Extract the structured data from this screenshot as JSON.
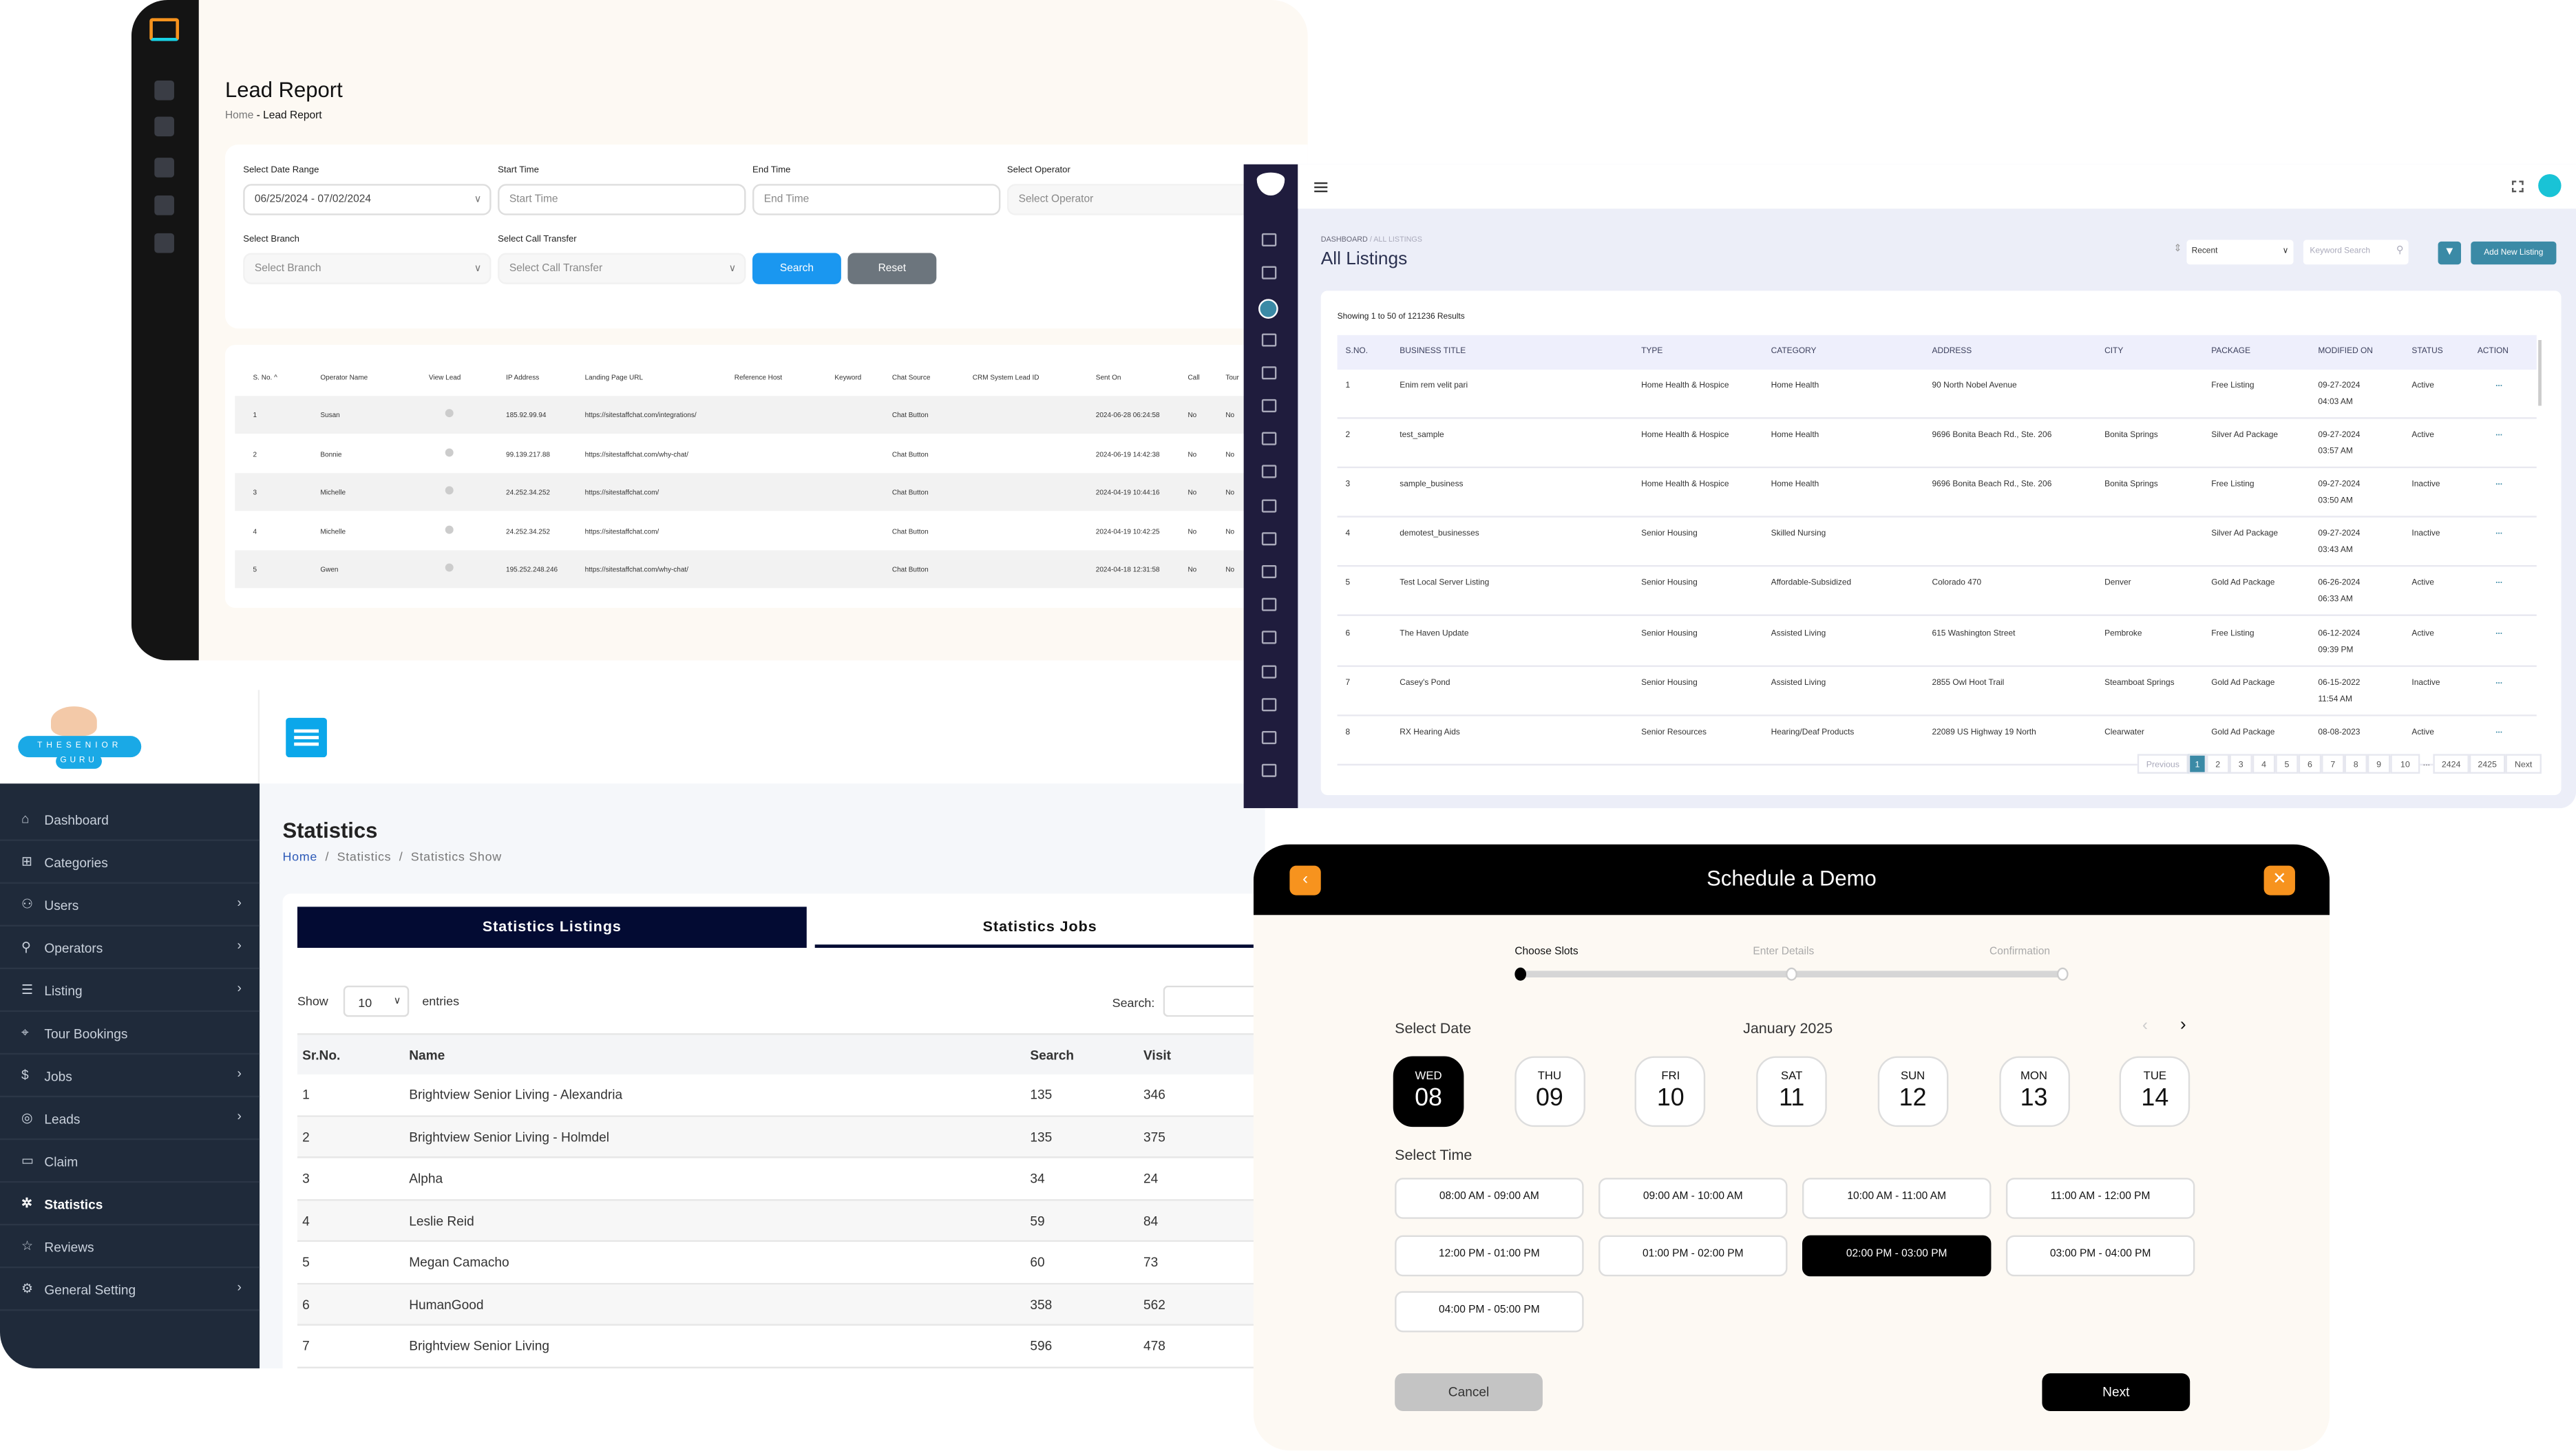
{
  "lead_report": {
    "title": "Lead Report",
    "breadcrumb_home": "Home",
    "breadcrumb_sep": "-",
    "breadcrumb_current": "Lead Report",
    "filters": {
      "date_range_label": "Select Date Range",
      "date_range_value": "06/25/2024 - 07/02/2024",
      "start_label": "Start Time",
      "start_placeholder": "Start Time",
      "end_label": "End Time",
      "end_placeholder": "End Time",
      "operator_label": "Select Operator",
      "operator_placeholder": "Select Operator",
      "branch_label": "Select Branch",
      "branch_placeholder": "Select Branch",
      "transfer_label": "Select Call Transfer",
      "transfer_placeholder": "Select Call Transfer",
      "search": "Search",
      "reset": "Reset"
    },
    "columns": [
      "S. No. ^",
      "Operator Name",
      "View Lead",
      "IP Address",
      "Landing Page URL",
      "Reference Host",
      "Keyword",
      "Chat Source",
      "CRM System Lead ID",
      "Sent On",
      "Call",
      "Tour"
    ],
    "rows": [
      [
        "1",
        "Susan",
        "185.92.99.94",
        "https://sitestaffchat.com/integrations/",
        "Chat Button",
        "2024-06-28 06:24:58",
        "No",
        "No"
      ],
      [
        "2",
        "Bonnie",
        "99.139.217.88",
        "https://sitestaffchat.com/why-chat/",
        "Chat Button",
        "2024-06-19 14:42:38",
        "No",
        "No"
      ],
      [
        "3",
        "Michelle",
        "24.252.34.252",
        "https://sitestaffchat.com/",
        "Chat Button",
        "2024-04-19 10:44:16",
        "No",
        "No"
      ],
      [
        "4",
        "Michelle",
        "24.252.34.252",
        "https://sitestaffchat.com/",
        "Chat Button",
        "2024-04-19 10:42:25",
        "No",
        "No"
      ],
      [
        "5",
        "Gwen",
        "195.252.248.246",
        "https://sitestaffchat.com/why-chat/",
        "Chat Button",
        "2024-04-18 12:31:58",
        "No",
        "No"
      ]
    ]
  },
  "listings": {
    "breadcrumb": "DASHBOARD",
    "breadcrumb_sep": "/",
    "breadcrumb_current": "ALL LISTINGS",
    "title": "All Listings",
    "sort_value": "Recent",
    "search_placeholder": "Keyword Search",
    "add_button": "Add New Listing",
    "showing": "Showing 1 to 50 of 121236 Results",
    "columns": [
      "S.NO.",
      "BUSINESS TITLE",
      "TYPE",
      "CATEGORY",
      "ADDRESS",
      "CITY",
      "PACKAGE",
      "MODIFIED ON",
      "STATUS",
      "ACTION"
    ],
    "rows": [
      [
        "1",
        "Enim rem velit pari",
        "Home Health & Hospice",
        "Home Health",
        "90 North Nobel Avenue",
        "",
        "Free Listing",
        "09-27-2024",
        "04:03 AM",
        "Active"
      ],
      [
        "2",
        "test_sample",
        "Home Health & Hospice",
        "Home Health",
        "9696 Bonita Beach Rd., Ste. 206",
        "Bonita Springs",
        "Silver Ad Package",
        "09-27-2024",
        "03:57 AM",
        "Active"
      ],
      [
        "3",
        "sample_business",
        "Home Health & Hospice",
        "Home Health",
        "9696 Bonita Beach Rd., Ste. 206",
        "Bonita Springs",
        "Free Listing",
        "09-27-2024",
        "03:50 AM",
        "Inactive"
      ],
      [
        "4",
        "demotest_businesses",
        "Senior Housing",
        "Skilled Nursing",
        "",
        "",
        "Silver Ad Package",
        "09-27-2024",
        "03:43 AM",
        "Inactive"
      ],
      [
        "5",
        "Test Local Server Listing",
        "Senior Housing",
        "Affordable-Subsidized",
        "Colorado 470",
        "Denver",
        "Gold Ad Package",
        "06-26-2024",
        "06:33 AM",
        "Active"
      ],
      [
        "6",
        "The Haven Update",
        "Senior Housing",
        "Assisted Living",
        "615 Washington Street",
        "Pembroke",
        "Free Listing",
        "06-12-2024",
        "09:39 PM",
        "Active"
      ],
      [
        "7",
        "Casey's Pond",
        "Senior Housing",
        "Assisted Living",
        "2855 Owl Hoot Trail",
        "Steamboat Springs",
        "Gold Ad Package",
        "06-15-2022",
        "11:54 AM",
        "Inactive"
      ],
      [
        "8",
        "RX Hearing Aids",
        "Senior Resources",
        "Hearing/Deaf Products",
        "22089 US Highway 19 North",
        "Clearwater",
        "Gold Ad Package",
        "08-08-2023",
        "",
        "Active"
      ]
    ],
    "action_label": "...",
    "pagination": [
      "Previous",
      "1",
      "2",
      "3",
      "4",
      "5",
      "6",
      "7",
      "8",
      "9",
      "10",
      "...",
      "2424",
      "2425",
      "Next"
    ],
    "current_page": "1",
    "accent": "#3b8aa6"
  },
  "statistics": {
    "logo_text": "THE SENIOR GURU",
    "nav": [
      {
        "icon": "⌂",
        "label": "Dashboard",
        "arrow": false
      },
      {
        "icon": "⊞",
        "label": "Categories",
        "arrow": false
      },
      {
        "icon": "⚇",
        "label": "Users",
        "arrow": true
      },
      {
        "icon": "⚲",
        "label": "Operators",
        "arrow": true
      },
      {
        "icon": "☰",
        "label": "Listing",
        "arrow": true
      },
      {
        "icon": "⌖",
        "label": "Tour Bookings",
        "arrow": false
      },
      {
        "icon": "$",
        "label": "Jobs",
        "arrow": true
      },
      {
        "icon": "◎",
        "label": "Leads",
        "arrow": true
      },
      {
        "icon": "▭",
        "label": "Claim",
        "arrow": false
      },
      {
        "icon": "✲",
        "label": "Statistics",
        "arrow": false,
        "active": true
      },
      {
        "icon": "☆",
        "label": "Reviews",
        "arrow": false
      },
      {
        "icon": "⚙",
        "label": "General Setting",
        "arrow": true
      }
    ],
    "title": "Statistics",
    "breadcrumb": [
      "Home",
      "Statistics",
      "Statistics Show"
    ],
    "tabs": [
      "Statistics Listings",
      "Statistics Jobs"
    ],
    "show_label": "Show",
    "entries_value": "10",
    "entries_label": "entries",
    "search_label": "Search:",
    "columns": [
      "Sr.No.",
      "Name",
      "Search",
      "Visit"
    ],
    "rows": [
      [
        "1",
        "Brightview Senior Living - Alexandria",
        "135",
        "346"
      ],
      [
        "2",
        "Brightview Senior Living - Holmdel",
        "135",
        "375"
      ],
      [
        "3",
        "Alpha",
        "34",
        "24"
      ],
      [
        "4",
        "Leslie Reid",
        "59",
        "84"
      ],
      [
        "5",
        "Megan Camacho",
        "60",
        "73"
      ],
      [
        "6",
        "HumanGood",
        "358",
        "562"
      ],
      [
        "7",
        "Brightview Senior Living",
        "596",
        "478"
      ]
    ]
  },
  "demo": {
    "title": "Schedule a Demo",
    "steps": [
      "Choose Slots",
      "Enter Details",
      "Confirmation"
    ],
    "select_date": "Select Date",
    "month": "January 2025",
    "days": [
      [
        "WED",
        "08"
      ],
      [
        "THU",
        "09"
      ],
      [
        "FRI",
        "10"
      ],
      [
        "SAT",
        "11"
      ],
      [
        "SUN",
        "12"
      ],
      [
        "MON",
        "13"
      ],
      [
        "TUE",
        "14"
      ]
    ],
    "selected_day": "08",
    "select_time": "Select Time",
    "slots": [
      "08:00 AM - 09:00 AM",
      "09:00 AM - 10:00 AM",
      "10:00 AM - 11:00 AM",
      "11:00 AM - 12:00 PM",
      "12:00 PM - 01:00 PM",
      "01:00 PM - 02:00 PM",
      "02:00 PM - 03:00 PM",
      "03:00 PM - 04:00 PM",
      "04:00 PM - 05:00 PM"
    ],
    "selected_slot": "02:00 PM - 03:00 PM",
    "cancel": "Cancel",
    "next": "Next",
    "accent": "#f7931e"
  }
}
